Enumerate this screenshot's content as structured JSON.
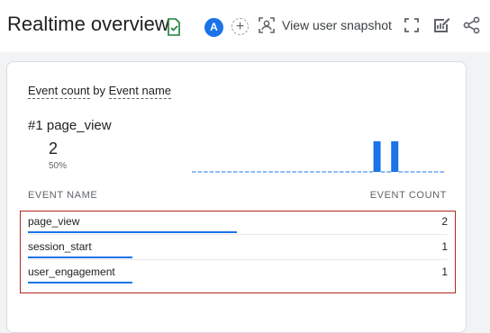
{
  "header": {
    "title": "Realtime overview",
    "avatar_letter": "A",
    "add_symbol": "+",
    "snapshot_label": "View user snapshot",
    "icons": [
      "verified-icon",
      "user-snapshot-icon",
      "fullscreen-icon",
      "customize-report-icon",
      "share-icon"
    ]
  },
  "card": {
    "title_metric": "Event count",
    "title_by": "by",
    "title_dimension": "Event name",
    "top_rank": "#1",
    "top_event": "page_view",
    "top_value": "2",
    "top_percent": "50%",
    "columns": {
      "name": "EVENT NAME",
      "count": "EVENT COUNT"
    },
    "rows": [
      {
        "name": "page_view",
        "count": "2",
        "share": 1.0
      },
      {
        "name": "session_start",
        "count": "1",
        "share": 0.5
      },
      {
        "name": "user_engagement",
        "count": "1",
        "share": 0.5
      }
    ]
  },
  "chart_data": {
    "type": "bar",
    "values": [
      0,
      0,
      0,
      0,
      0,
      0,
      0,
      0,
      0,
      0,
      0,
      0,
      0,
      0,
      0,
      0,
      0,
      0,
      0,
      0,
      0,
      0,
      0,
      0,
      0,
      0,
      0,
      0,
      0,
      0,
      0,
      1,
      0,
      0,
      1,
      0,
      0,
      0,
      0,
      0,
      0,
      0,
      0
    ],
    "highlight_color": "#1a73e8",
    "baseline_color": "#1a73e8"
  },
  "colors": {
    "accent": "#1a73e8",
    "highlight_border": "#b3261e",
    "verified": "#188038"
  }
}
